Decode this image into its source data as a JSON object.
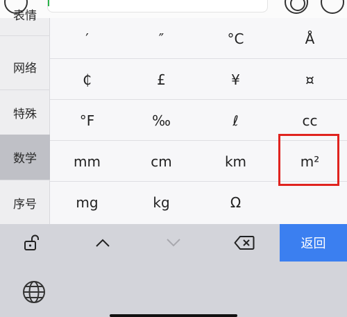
{
  "sidebar": {
    "items": [
      {
        "label": "表情"
      },
      {
        "label": "网络"
      },
      {
        "label": "特殊"
      },
      {
        "label": "数学"
      },
      {
        "label": "序号"
      }
    ],
    "active_index": 3
  },
  "grid": {
    "rows": [
      [
        "′",
        "″",
        "°C",
        "Å"
      ],
      [
        "₵",
        "£",
        "¥",
        "¤"
      ],
      [
        "°F",
        "‰",
        "ℓ",
        "cc"
      ],
      [
        "mm",
        "cm",
        "km",
        "m²"
      ],
      [
        "mg",
        "kg",
        "Ω",
        ""
      ]
    ]
  },
  "toolbar": {
    "back_label": "返回"
  },
  "colors": {
    "accent": "#3b7ff0",
    "highlight": "#e0231f",
    "active_category": "#bfc0c6"
  },
  "icons": {
    "lock": "lock-open-icon",
    "up": "chevron-up-icon",
    "down": "chevron-down-icon",
    "delete": "backspace-icon",
    "globe": "globe-icon"
  }
}
